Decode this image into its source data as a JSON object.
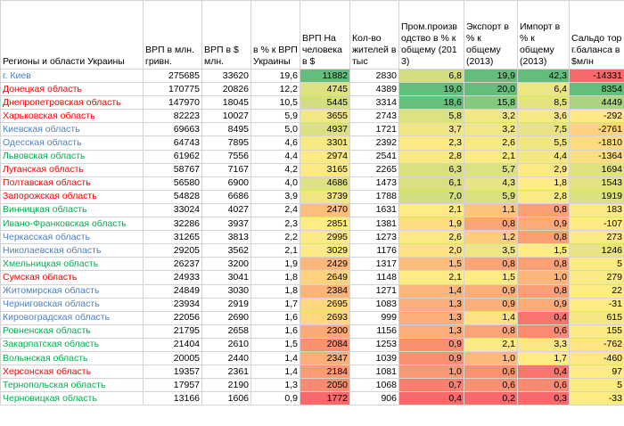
{
  "columns": [
    "Регионы и области Украины",
    "ВРП в млн. гривн.",
    "ВРП в $ млн.",
    "в % к ВРП Украины",
    "ВРП На человека в $",
    "Кол-во жителей в тыс",
    "Пром.производство в % к общему (2013)",
    "Экспорт в % к общему (2013)",
    "Импорт в % к общему (2013)",
    "Сальдо торг.баланса в $млн"
  ],
  "colors": {
    "red": "#ff0000",
    "blue": "#4f81bd",
    "green": "#00b050"
  },
  "rows": [
    {
      "name": "г. Киев",
      "color": "blue",
      "vrp_uah": "275685",
      "vrp_usd": "33620",
      "pct_ukraine": "19,6",
      "per_capita": "11882",
      "population": "2830",
      "industry": "6,8",
      "export": "19,9",
      "import": "42,3",
      "balance": "-14331"
    },
    {
      "name": "Донецкая область",
      "color": "red",
      "vrp_uah": "170775",
      "vrp_usd": "20826",
      "pct_ukraine": "12,2",
      "per_capita": "4745",
      "population": "4389",
      "industry": "19,0",
      "export": "20,0",
      "import": "6,4",
      "balance": "8354"
    },
    {
      "name": "Днепропетровская область",
      "color": "red",
      "vrp_uah": "147970",
      "vrp_usd": "18045",
      "pct_ukraine": "10,5",
      "per_capita": "5445",
      "population": "3314",
      "industry": "18,6",
      "export": "15,8",
      "import": "8,5",
      "balance": "4449"
    },
    {
      "name": "Харьковская область",
      "color": "red",
      "vrp_uah": "82223",
      "vrp_usd": "10027",
      "pct_ukraine": "5,9",
      "per_capita": "3655",
      "population": "2743",
      "industry": "5,8",
      "export": "3,2",
      "import": "3,6",
      "balance": "-292"
    },
    {
      "name": "Киевская область",
      "color": "blue",
      "vrp_uah": "69663",
      "vrp_usd": "8495",
      "pct_ukraine": "5,0",
      "per_capita": "4937",
      "population": "1721",
      "industry": "3,7",
      "export": "3,2",
      "import": "7,5",
      "balance": "-2761"
    },
    {
      "name": "Одесская область",
      "color": "blue",
      "vrp_uah": "64743",
      "vrp_usd": "7895",
      "pct_ukraine": "4,6",
      "per_capita": "3301",
      "population": "2392",
      "industry": "2,3",
      "export": "2,6",
      "import": "5,5",
      "balance": "-1810"
    },
    {
      "name": "Львовская область",
      "color": "green",
      "vrp_uah": "61962",
      "vrp_usd": "7556",
      "pct_ukraine": "4,4",
      "per_capita": "2974",
      "population": "2541",
      "industry": "2,8",
      "export": "2,1",
      "import": "4,4",
      "balance": "-1364"
    },
    {
      "name": "Луганская область",
      "color": "red",
      "vrp_uah": "58767",
      "vrp_usd": "7167",
      "pct_ukraine": "4,2",
      "per_capita": "3165",
      "population": "2265",
      "industry": "6,3",
      "export": "5,7",
      "import": "2,9",
      "balance": "1694"
    },
    {
      "name": "Полтавская область",
      "color": "red",
      "vrp_uah": "56580",
      "vrp_usd": "6900",
      "pct_ukraine": "4,0",
      "per_capita": "4686",
      "population": "1473",
      "industry": "6,1",
      "export": "4,3",
      "import": "1,8",
      "balance": "1543"
    },
    {
      "name": "Запорожская область",
      "color": "red",
      "vrp_uah": "54828",
      "vrp_usd": "6686",
      "pct_ukraine": "3,9",
      "per_capita": "3739",
      "population": "1788",
      "industry": "7,0",
      "export": "5,9",
      "import": "2,8",
      "balance": "1919"
    },
    {
      "name": "Винницкая область",
      "color": "green",
      "vrp_uah": "33024",
      "vrp_usd": "4027",
      "pct_ukraine": "2,4",
      "per_capita": "2470",
      "population": "1631",
      "industry": "2,1",
      "export": "1,1",
      "import": "0,8",
      "balance": "183"
    },
    {
      "name": "Ивано-Франковская область",
      "color": "green",
      "vrp_uah": "32286",
      "vrp_usd": "3937",
      "pct_ukraine": "2,3",
      "per_capita": "2851",
      "population": "1381",
      "industry": "1,9",
      "export": "0,8",
      "import": "0,9",
      "balance": "-107"
    },
    {
      "name": "Черкасская область",
      "color": "blue",
      "vrp_uah": "31265",
      "vrp_usd": "3813",
      "pct_ukraine": "2,2",
      "per_capita": "2995",
      "population": "1273",
      "industry": "2,6",
      "export": "1,2",
      "import": "0,8",
      "balance": "273"
    },
    {
      "name": "Николаевская область",
      "color": "blue",
      "vrp_uah": "29205",
      "vrp_usd": "3562",
      "pct_ukraine": "2,1",
      "per_capita": "3029",
      "population": "1176",
      "industry": "2,0",
      "export": "3,5",
      "import": "1,5",
      "balance": "1246"
    },
    {
      "name": "Хмельницкая область",
      "color": "green",
      "vrp_uah": "26237",
      "vrp_usd": "3200",
      "pct_ukraine": "1,9",
      "per_capita": "2429",
      "population": "1317",
      "industry": "1,5",
      "export": "0,8",
      "import": "0,8",
      "balance": "5"
    },
    {
      "name": "Сумская область",
      "color": "red",
      "vrp_uah": "24933",
      "vrp_usd": "3041",
      "pct_ukraine": "1,8",
      "per_capita": "2649",
      "population": "1148",
      "industry": "2,1",
      "export": "1,5",
      "import": "1,0",
      "balance": "279"
    },
    {
      "name": "Житомирская область",
      "color": "blue",
      "vrp_uah": "24849",
      "vrp_usd": "3030",
      "pct_ukraine": "1,8",
      "per_capita": "2384",
      "population": "1271",
      "industry": "1,4",
      "export": "0,9",
      "import": "0,8",
      "balance": "22"
    },
    {
      "name": "Черниговская область",
      "color": "blue",
      "vrp_uah": "23934",
      "vrp_usd": "2919",
      "pct_ukraine": "1,7",
      "per_capita": "2695",
      "population": "1083",
      "industry": "1,3",
      "export": "0,9",
      "import": "0,9",
      "balance": "-31"
    },
    {
      "name": "Кировоградская область",
      "color": "blue",
      "vrp_uah": "22056",
      "vrp_usd": "2690",
      "pct_ukraine": "1,6",
      "per_capita": "2693",
      "population": "999",
      "industry": "1,3",
      "export": "1,4",
      "import": "0,4",
      "balance": "615"
    },
    {
      "name": "Ровненская область",
      "color": "green",
      "vrp_uah": "21795",
      "vrp_usd": "2658",
      "pct_ukraine": "1,6",
      "per_capita": "2300",
      "population": "1156",
      "industry": "1,3",
      "export": "0,8",
      "import": "0,6",
      "balance": "155"
    },
    {
      "name": "Закарпатская область",
      "color": "green",
      "vrp_uah": "21404",
      "vrp_usd": "2610",
      "pct_ukraine": "1,5",
      "per_capita": "2084",
      "population": "1253",
      "industry": "0,9",
      "export": "2,1",
      "import": "3,3",
      "balance": "-762"
    },
    {
      "name": "Волынская область",
      "color": "green",
      "vrp_uah": "20005",
      "vrp_usd": "2440",
      "pct_ukraine": "1,4",
      "per_capita": "2347",
      "population": "1039",
      "industry": "0,9",
      "export": "1,0",
      "import": "1,7",
      "balance": "-460"
    },
    {
      "name": "Херсонская область",
      "color": "red",
      "vrp_uah": "19357",
      "vrp_usd": "2361",
      "pct_ukraine": "1,4",
      "per_capita": "2184",
      "population": "1081",
      "industry": "1,0",
      "export": "0,6",
      "import": "0,4",
      "balance": "97"
    },
    {
      "name": "Тернопольская область",
      "color": "green",
      "vrp_uah": "17957",
      "vrp_usd": "2190",
      "pct_ukraine": "1,3",
      "per_capita": "2050",
      "population": "1068",
      "industry": "0,7",
      "export": "0,6",
      "import": "0,6",
      "balance": "5"
    },
    {
      "name": "Черновицкая область",
      "color": "green",
      "vrp_uah": "13166",
      "vrp_usd": "1606",
      "pct_ukraine": "0,9",
      "per_capita": "1772",
      "population": "906",
      "industry": "0,4",
      "export": "0,2",
      "import": "0,3",
      "balance": "-33"
    }
  ]
}
